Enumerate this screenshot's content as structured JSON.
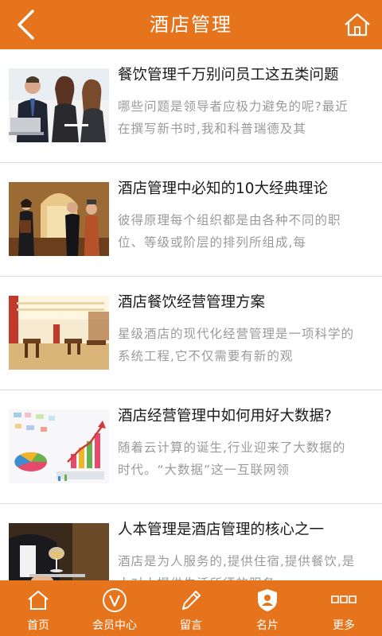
{
  "header": {
    "title": "酒店管理",
    "back_icon": "back-arrow-icon",
    "home_icon": "home-icon"
  },
  "articles": [
    {
      "title": "餐饮管理千万别问员工这五类问题",
      "desc": "哪些问题是领导者应极力避免的呢?最近在撰写新书时,我和科普瑞德及其",
      "image": "business-meeting-photo"
    },
    {
      "title": "酒店管理中必知的10大经典理论",
      "desc": "彼得原理每个组织都是由各种不同的职位、等级或阶层的排列所组成,每",
      "image": "hotel-staff-photo"
    },
    {
      "title": "酒店餐饮经营管理方案",
      "desc": "星级酒店的现代化经营管理是一项科学的系统工程,它不仅需要有新的观",
      "image": "restaurant-interior-photo"
    },
    {
      "title": "酒店经营管理中如何用好大数据?",
      "desc": "随着云计算的诞生,行业迎来了大数据的时代。“大数据”这一互联网领",
      "image": "data-charts-photo"
    },
    {
      "title": "人本管理是酒店管理的核心之一",
      "desc": "酒店是为人服务的,提供住宿,提供餐饮,是人对人提供生活所须的服务",
      "image": "waiter-serving-photo"
    }
  ],
  "tabbar": {
    "tabs": [
      {
        "label": "首页",
        "icon": "home-icon"
      },
      {
        "label": "会员中心",
        "icon": "member-v-icon"
      },
      {
        "label": "留言",
        "icon": "pencil-icon"
      },
      {
        "label": "名片",
        "icon": "card-shield-icon"
      },
      {
        "label": "更多",
        "icon": "more-grid-icon"
      }
    ]
  },
  "colors": {
    "brand": "#e6741c",
    "title_text": "#1a1a1a",
    "desc_text": "#9a9a9a",
    "divider": "#d9d9d9"
  }
}
